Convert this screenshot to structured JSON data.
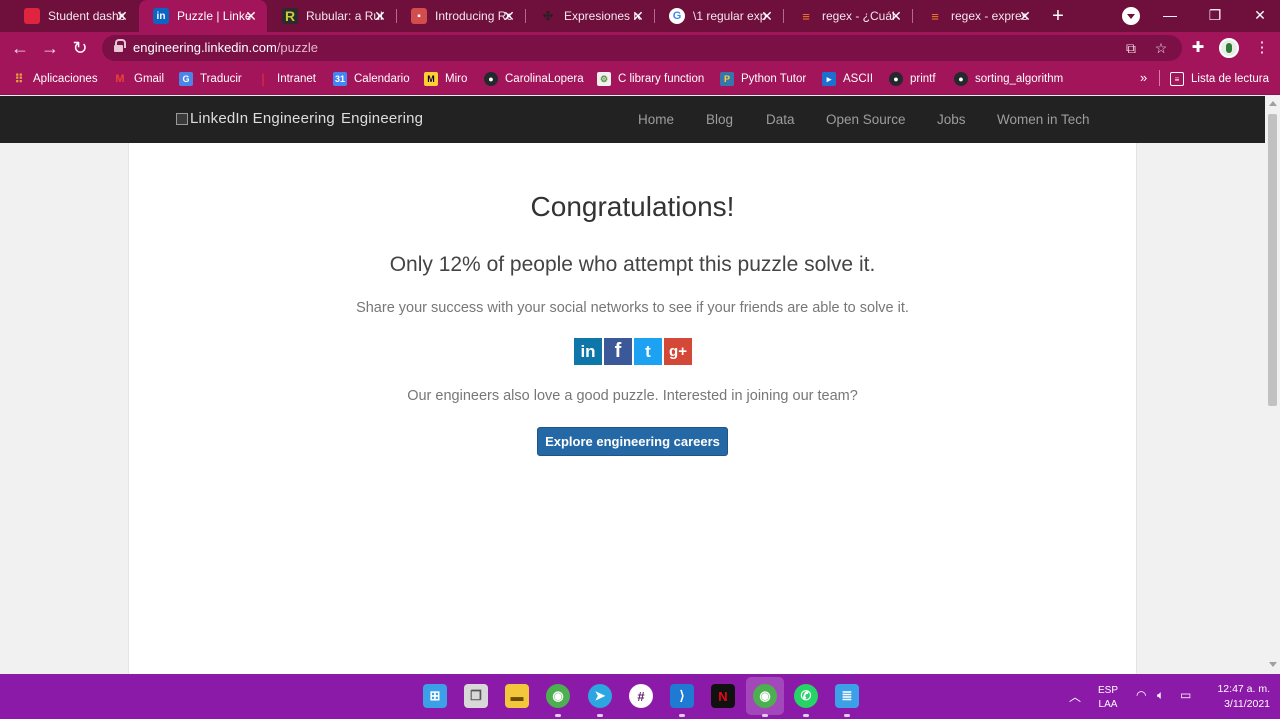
{
  "browser": {
    "tabs": [
      {
        "title": "Student dashb",
        "favicon": "holberton-icon",
        "color": "#e0233f"
      },
      {
        "title": "Puzzle | Linke",
        "favicon": "linkedin-icon",
        "color": "#0a66c2",
        "active": true
      },
      {
        "title": "Rubular: a Rub",
        "favicon": "rubular-icon",
        "color": "#c7cc3a"
      },
      {
        "title": "Introducing Re",
        "favicon": "document-icon",
        "color": "#d44d4d"
      },
      {
        "title": "Expresiones re",
        "favicon": "dots-icon",
        "color": "#333333"
      },
      {
        "title": "\\1 regular exp",
        "favicon": "google-icon",
        "color": "#ffffff"
      },
      {
        "title": "regex - ¿Cuál",
        "favicon": "stackoverflow-icon",
        "color": "#f48024"
      },
      {
        "title": "regex - expres",
        "favicon": "stackoverflow-icon",
        "color": "#f48024"
      }
    ],
    "new_tab_label": "+",
    "url_host": "engineering.linkedin.com",
    "url_path": "/puzzle",
    "bookmarks": [
      {
        "label": "Aplicaciones",
        "icon": "apps-grid-icon",
        "color": "#e8a33c"
      },
      {
        "label": "Gmail",
        "icon": "gmail-icon",
        "color": "#d93025"
      },
      {
        "label": "Traducir",
        "icon": "translate-icon",
        "color": "#4a86e8"
      },
      {
        "label": "Intranet",
        "icon": "holberton-icon",
        "color": "#e0233f"
      },
      {
        "label": "Calendario",
        "icon": "calendar-icon",
        "color": "#4285f4"
      },
      {
        "label": "Miro",
        "icon": "miro-icon",
        "color": "#ffd02f"
      },
      {
        "label": "CarolinaLopera",
        "icon": "github-icon",
        "color": "#24292e"
      },
      {
        "label": "C library function",
        "icon": "tutorialspoint-icon",
        "color": "#5a8f3d"
      },
      {
        "label": "Python Tutor",
        "icon": "python-icon",
        "color": "#3776ab"
      },
      {
        "label": "ASCII",
        "icon": "ascii-icon",
        "color": "#1e6fd1"
      },
      {
        "label": "printf",
        "icon": "github-icon",
        "color": "#24292e"
      },
      {
        "label": "sorting_algorithm",
        "icon": "github-icon",
        "color": "#24292e"
      }
    ],
    "more_bookmarks": "»",
    "reading_list": "Lista de lectura"
  },
  "site": {
    "logo_alt": "LinkedIn Engineering",
    "logo_word": "Engineering",
    "nav": [
      "Home",
      "Blog",
      "Data",
      "Open Source",
      "Jobs",
      "Women in Tech"
    ]
  },
  "main": {
    "headline": "Congratulations!",
    "subhead": "Only 12% of people who attempt this puzzle solve it.",
    "share_text": "Share your success with your social networks to see if your friends are able to solve it.",
    "social": [
      {
        "name": "linkedin-share",
        "glyph": "in",
        "color": "#0e76a8"
      },
      {
        "name": "facebook-share",
        "glyph": "f",
        "color": "#3b5998"
      },
      {
        "name": "twitter-share",
        "glyph": "t",
        "color": "#1da1f2"
      },
      {
        "name": "googleplus-share",
        "glyph": "g+",
        "color": "#d34836"
      }
    ],
    "join_text": "Our engineers also love a good puzzle. Interested in joining our team?",
    "cta": "Explore engineering careers"
  },
  "taskbar": {
    "lang_top": "ESP",
    "lang_bottom": "LAA",
    "time": "12:47 a. m.",
    "date": "3/11/2021"
  },
  "colors": {
    "tab_strip": "#6e0f3c",
    "toolbar": "#a3155a",
    "site_nav": "#222222",
    "cta": "#2568a6",
    "taskbar": "#8c1aa8"
  }
}
